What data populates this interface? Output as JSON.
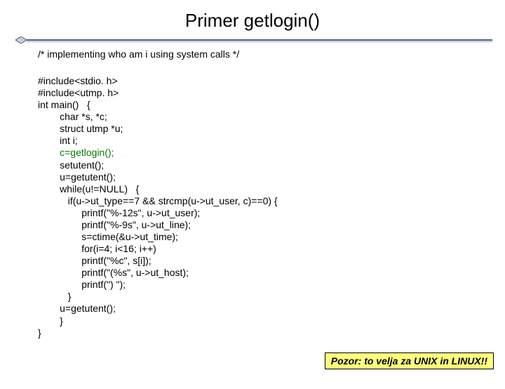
{
  "title": "Primer getlogin()",
  "comment": "/*   implementing who am i using system calls   */",
  "code": {
    "l1": "#include<stdio. h>",
    "l2": "#include<utmp. h>",
    "l3": "int main()   {",
    "l4": "        char *s, *c;",
    "l5": "        struct utmp *u;",
    "l6": "        int i;",
    "l7": "        c=getlogin();",
    "l8": "        setutent();",
    "l9": "        u=getutent();",
    "l10": "        while(u!=NULL)   {",
    "l11": "           if(u->ut_type==7 && strcmp(u->ut_user, c)==0) {",
    "l12": "                printf(\"%-12s\", u->ut_user);",
    "l13": "                printf(\"%-9s\", u->ut_line);",
    "l14": "                s=ctime(&u->ut_time);",
    "l15": "                for(i=4; i<16; i++)",
    "l16": "                printf(\"%c\", s[i]);",
    "l17": "                printf(\"(%s\", u->ut_host);",
    "l18": "                printf(\") \");",
    "l19": "           }",
    "l20": "        u=getutent();",
    "l21": "        }",
    "l22": "}"
  },
  "callout": "Pozor: to velja za UNIX in LINUX!!"
}
